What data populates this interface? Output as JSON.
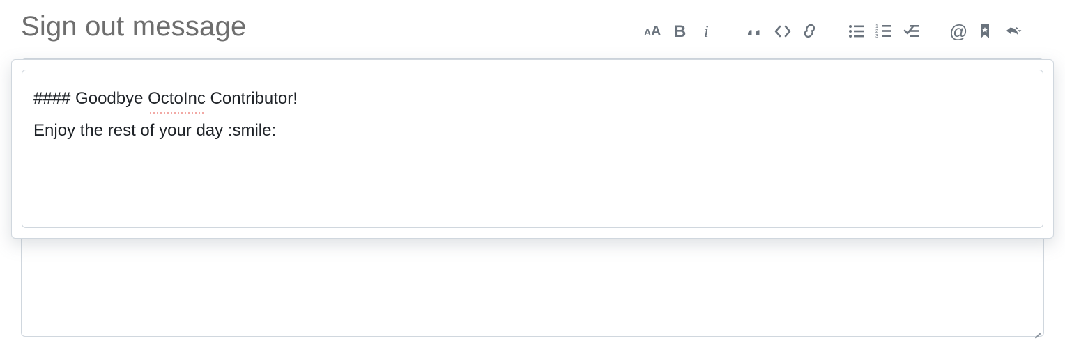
{
  "title": "Sign out message",
  "toolbar": {
    "groups": [
      {
        "items": [
          {
            "name": "heading-icon",
            "title": "Heading",
            "svg": "heading"
          },
          {
            "name": "bold-icon",
            "title": "Bold",
            "svg": "bold"
          },
          {
            "name": "italic-icon",
            "title": "Italic",
            "svg": "italic"
          }
        ]
      },
      {
        "items": [
          {
            "name": "quote-icon",
            "title": "Quote",
            "svg": "quote"
          },
          {
            "name": "code-icon",
            "title": "Code",
            "svg": "code"
          },
          {
            "name": "link-icon",
            "title": "Link",
            "svg": "link"
          }
        ]
      },
      {
        "items": [
          {
            "name": "bulleted-list-icon",
            "title": "Bulleted list",
            "svg": "ul"
          },
          {
            "name": "numbered-list-icon",
            "title": "Numbered list",
            "svg": "ol"
          },
          {
            "name": "task-list-icon",
            "title": "Task list",
            "svg": "tasklist"
          }
        ]
      },
      {
        "items": [
          {
            "name": "mention-icon",
            "title": "Mention",
            "svg": "mention"
          },
          {
            "name": "saved-reply-icon",
            "title": "Saved reply",
            "svg": "bookmark"
          },
          {
            "name": "reply-icon",
            "title": "Reply",
            "svg": "reply"
          }
        ]
      }
    ]
  },
  "editor": {
    "line1_prefix": "#### Goodbye ",
    "line1_spell": "OctoInc",
    "line1_suffix": " Contributor!",
    "line2": "Enjoy the rest of your day :smile:"
  }
}
